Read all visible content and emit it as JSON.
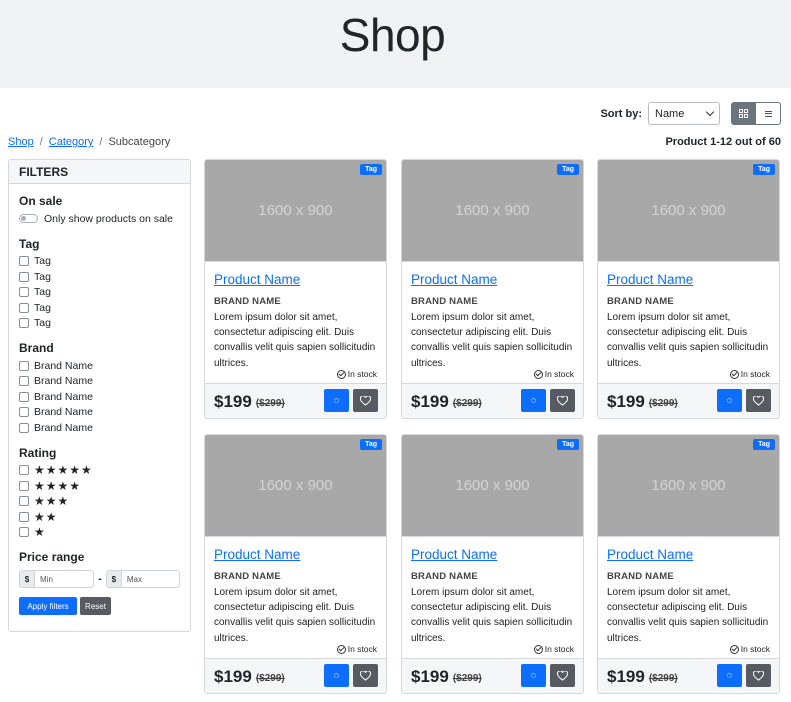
{
  "header": {
    "title": "Shop"
  },
  "toolbar": {
    "sort_label": "Sort by:",
    "sort_value": "Name",
    "grid_view_icon": "grid-icon",
    "list_view_icon": "list-icon"
  },
  "breadcrumb": {
    "items": [
      "Shop",
      "Category"
    ],
    "current": "Subcategory",
    "separator": "/"
  },
  "result_count": "Product 1-12 out of 60",
  "filters": {
    "title": "FILTERS",
    "on_sale": {
      "title": "On sale",
      "toggle_label": "Only show products on sale",
      "checked": false
    },
    "tag": {
      "title": "Tag",
      "options": [
        "Tag",
        "Tag",
        "Tag",
        "Tag",
        "Tag"
      ]
    },
    "brand": {
      "title": "Brand",
      "options": [
        "Brand Name",
        "Brand Name",
        "Brand Name",
        "Brand Name",
        "Brand Name"
      ]
    },
    "rating": {
      "title": "Rating",
      "options": [
        "★★★★★",
        "★★★★",
        "★★★",
        "★★",
        "★"
      ]
    },
    "price_range": {
      "title": "Price range",
      "currency": "$",
      "min_placeholder": "Min",
      "separator": "-",
      "max_placeholder": "Max"
    },
    "apply_label": "Apply filters",
    "reset_label": "Reset"
  },
  "products": [
    {
      "image_text": "1600 x 900",
      "tag": "Tag",
      "name": "Product Name",
      "brand": "BRAND NAME",
      "description": "Lorem ipsum dolor sit amet, consectetur adipiscing elit. Duis convallis velit quis sapien sollicitudin ultrices.",
      "stock": "In stock",
      "price": "$199",
      "old_price": "($299)"
    },
    {
      "image_text": "1600 x 900",
      "tag": "Tag",
      "name": "Product Name",
      "brand": "BRAND NAME",
      "description": "Lorem ipsum dolor sit amet, consectetur adipiscing elit. Duis convallis velit quis sapien sollicitudin ultrices.",
      "stock": "In stock",
      "price": "$199",
      "old_price": "($299)"
    },
    {
      "image_text": "1600 x 900",
      "tag": "Tag",
      "name": "Product Name",
      "brand": "BRAND NAME",
      "description": "Lorem ipsum dolor sit amet, consectetur adipiscing elit. Duis convallis velit quis sapien sollicitudin ultrices.",
      "stock": "In stock",
      "price": "$199",
      "old_price": "($299)"
    },
    {
      "image_text": "1600 x 900",
      "tag": "Tag",
      "name": "Product Name",
      "brand": "BRAND NAME",
      "description": "Lorem ipsum dolor sit amet, consectetur adipiscing elit. Duis convallis velit quis sapien sollicitudin ultrices.",
      "stock": "In stock",
      "price": "$199",
      "old_price": "($299)"
    },
    {
      "image_text": "1600 x 900",
      "tag": "Tag",
      "name": "Product Name",
      "brand": "BRAND NAME",
      "description": "Lorem ipsum dolor sit amet, consectetur adipiscing elit. Duis convallis velit quis sapien sollicitudin ultrices.",
      "stock": "In stock",
      "price": "$199",
      "old_price": "($299)"
    },
    {
      "image_text": "1600 x 900",
      "tag": "Tag",
      "name": "Product Name",
      "brand": "BRAND NAME",
      "description": "Lorem ipsum dolor sit amet, consectetur adipiscing elit. Duis convallis velit quis sapien sollicitudin ultrices.",
      "stock": "In stock",
      "price": "$199",
      "old_price": "($299)"
    }
  ],
  "colors": {
    "primary": "#0d6efd",
    "secondary": "#555b61",
    "image_placeholder": "#a8a8a8",
    "hero_bg": "#f1f2f3"
  }
}
